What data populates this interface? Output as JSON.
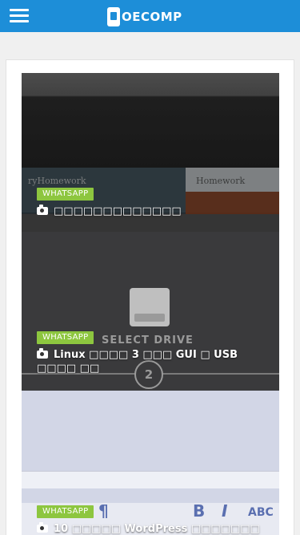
{
  "header": {
    "logo_text": "OECOMP",
    "brand_color": "#1d8ed8"
  },
  "posts": [
    {
      "category": "WHATSAPP",
      "title": "□□□□□□□□□□□□□",
      "icon": "camera-icon",
      "image_texts": [
        "ryHomework",
        "Homework"
      ]
    },
    {
      "category": "WHATSAPP",
      "title": "Linux □□□□ 3 □□□ GUI □ USB □□□□ □□",
      "icon": "camera-icon",
      "image_texts": [
        "SELECT DRIVE",
        "2"
      ]
    },
    {
      "category": "WHATSAPP",
      "title": "10 □□□□□ WordPress □□□□□□□",
      "icon": "camera-icon",
      "image_texts": [
        "¶",
        "B",
        "I",
        "ABC"
      ]
    }
  ],
  "colors": {
    "tag": "#8dc63f",
    "page_bg": "#f0f0f0"
  }
}
